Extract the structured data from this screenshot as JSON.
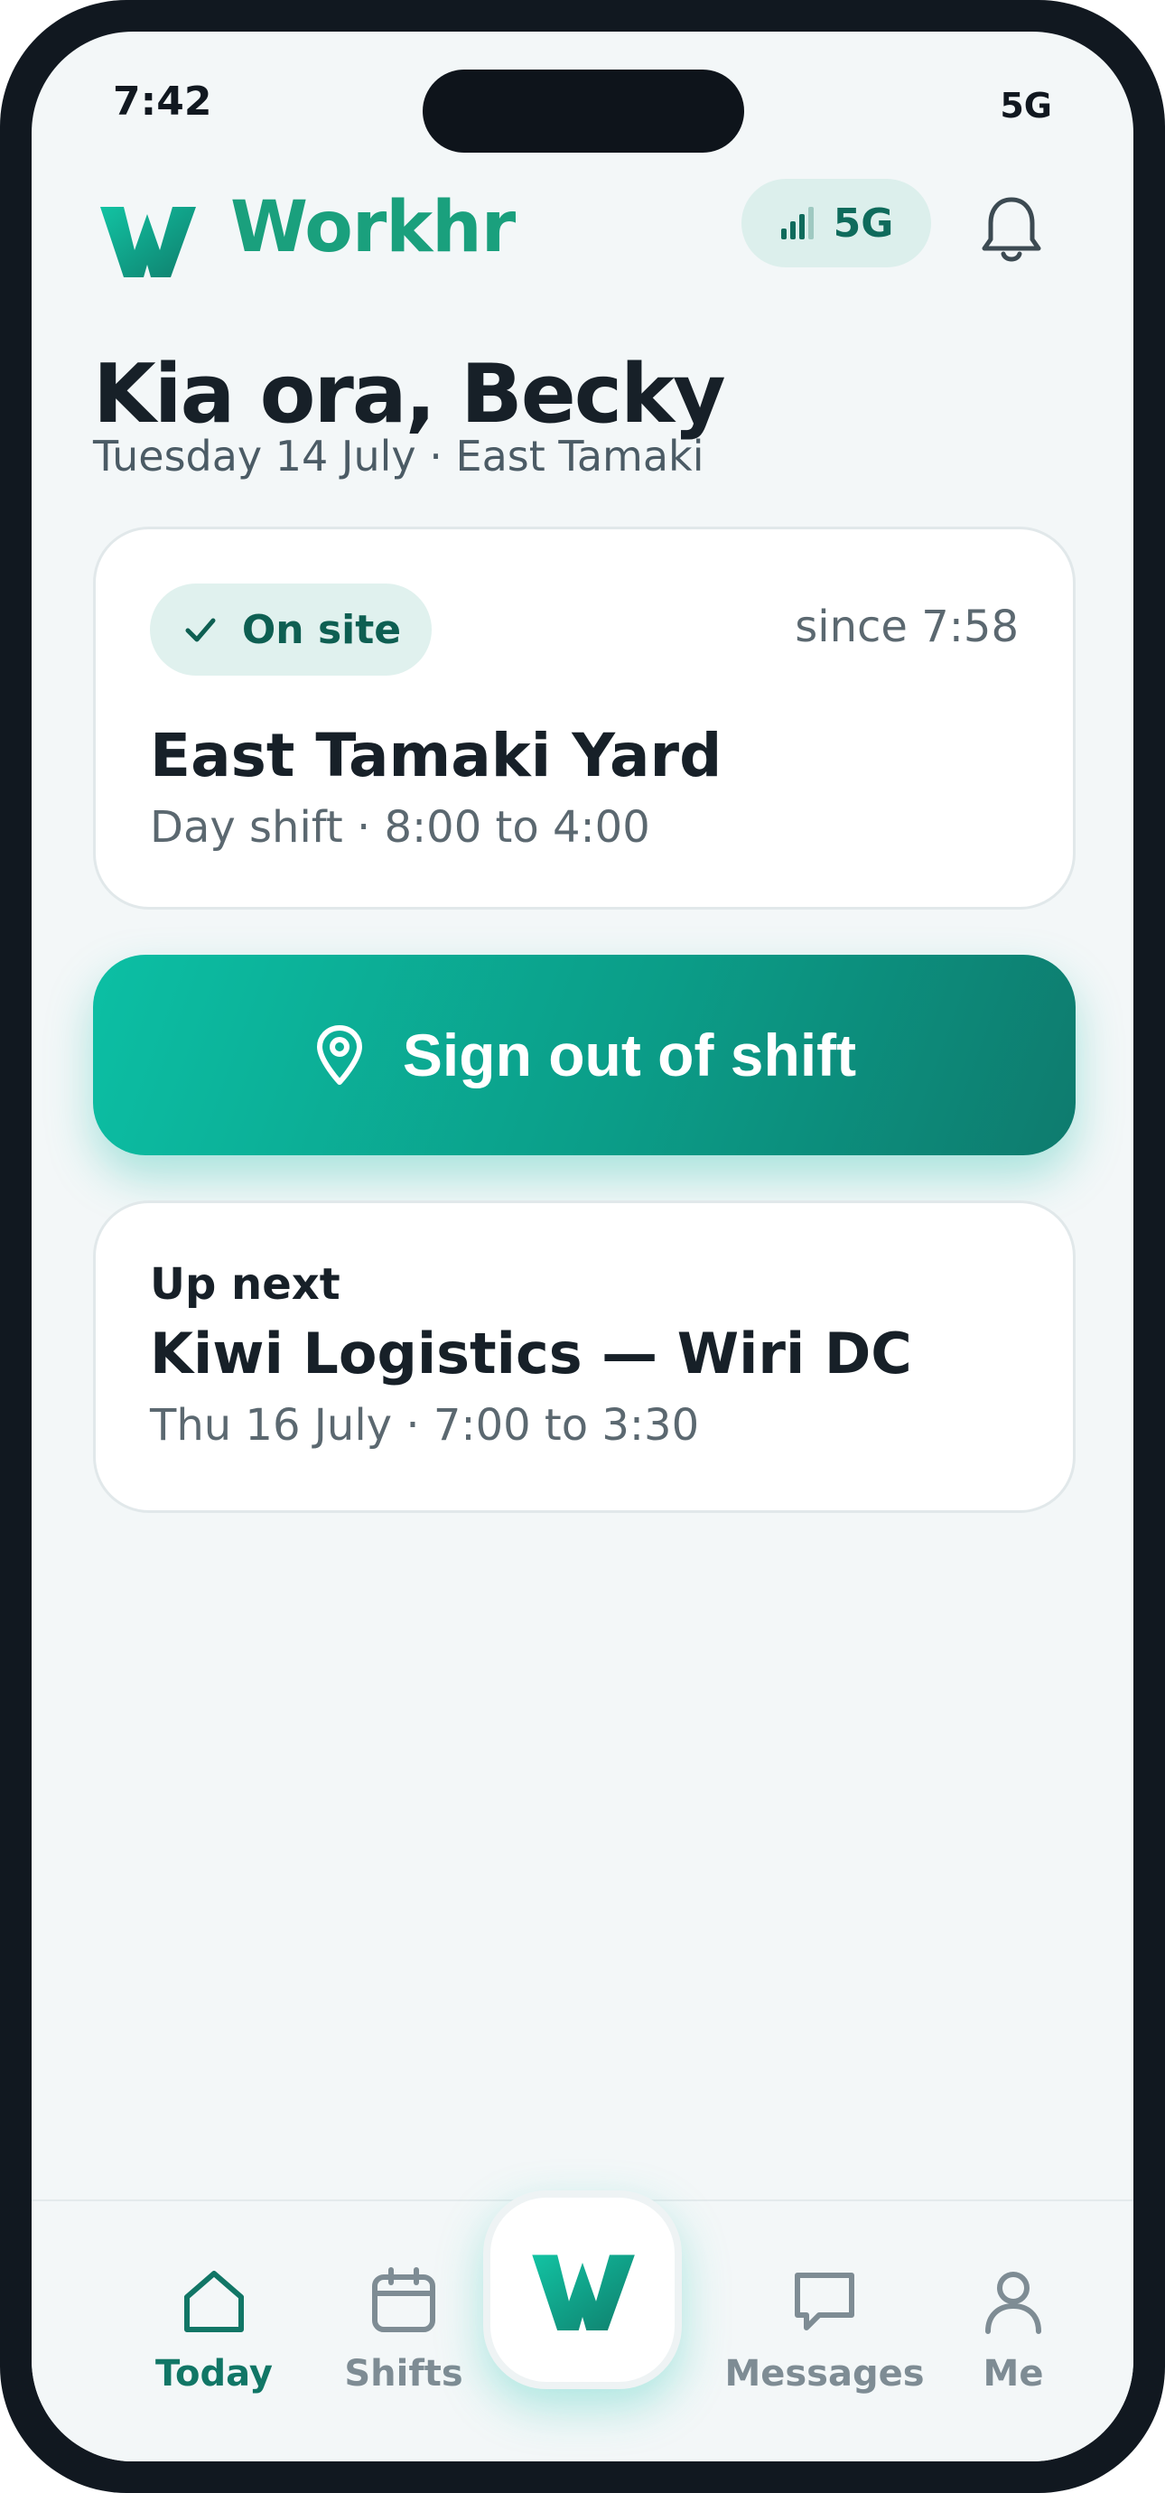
{
  "status_bar": {
    "time": "7:42",
    "network": "5G"
  },
  "header": {
    "brand": "Workhr",
    "network_pill": "5G"
  },
  "greeting": {
    "title": "Kia ora, Becky",
    "subtitle": "Tuesday 14 July · East Tamaki"
  },
  "current_shift": {
    "badge": "On site",
    "since": "since 7:58",
    "site": "East Tamaki Yard",
    "details": "Day shift · 8:00 to 4:00"
  },
  "cta": {
    "label": "Sign out of shift"
  },
  "up_next": {
    "heading": "Up next",
    "title": "Kiwi Logistics — Wiri DC",
    "details": "Thu 16 July · 7:00 to 3:30"
  },
  "tabs": [
    {
      "label": "Today",
      "icon": "home-icon",
      "active": true
    },
    {
      "label": "Shifts",
      "icon": "calendar-icon",
      "active": false
    },
    {
      "label": "Messages",
      "icon": "chat-icon",
      "active": false
    },
    {
      "label": "Me",
      "icon": "person-icon",
      "active": false
    }
  ],
  "colors": {
    "accent": "#0b9d88",
    "brand": "#1aa07d",
    "active_tab": "#117666"
  }
}
